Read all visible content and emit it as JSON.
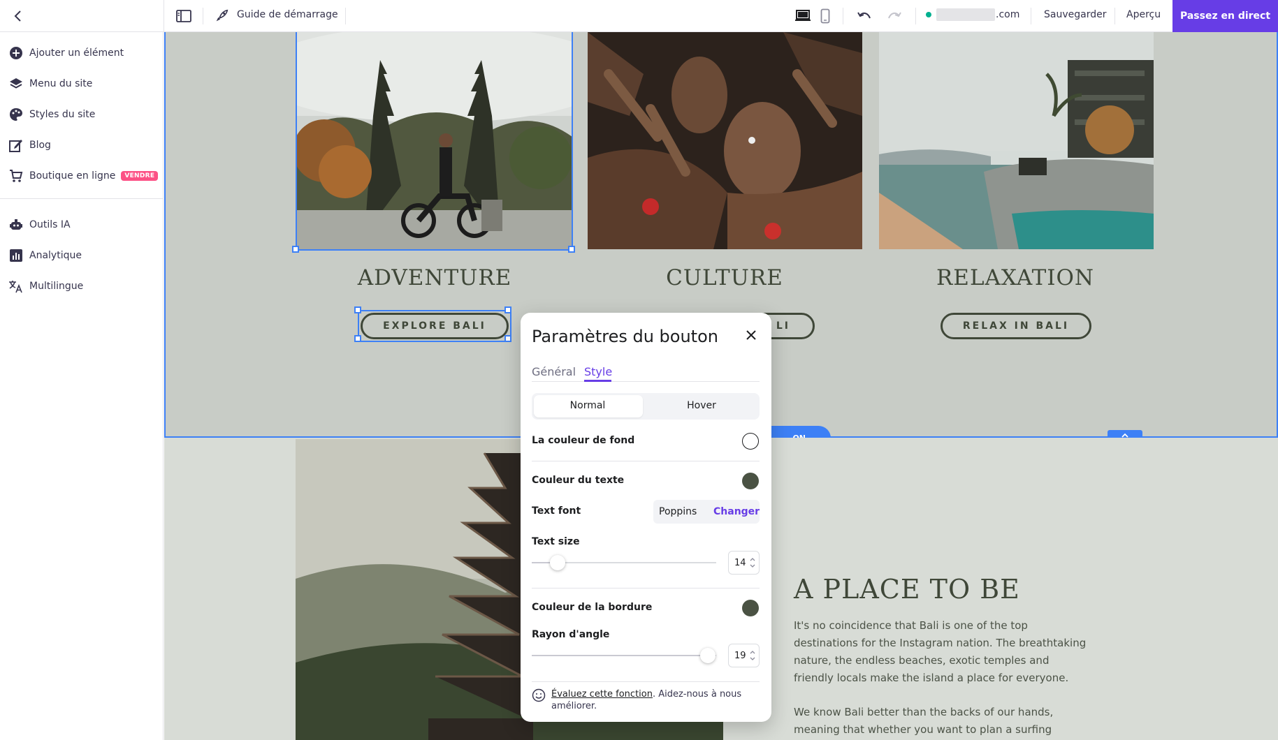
{
  "topbar": {
    "guide_label": "Guide de démarrage",
    "domain_suffix": ".com",
    "save_label": "Sauvegarder",
    "preview_label": "Aperçu",
    "publish_label": "Passez en direct"
  },
  "sidebar": {
    "items": [
      {
        "label": "Ajouter un élément"
      },
      {
        "label": "Menu du site"
      },
      {
        "label": "Styles du site"
      },
      {
        "label": "Blog"
      },
      {
        "label": "Boutique en ligne",
        "badge": "VENDRE"
      },
      {
        "label": "Outils IA"
      },
      {
        "label": "Analytique"
      },
      {
        "label": "Multilingue"
      }
    ]
  },
  "canvas": {
    "columns": [
      {
        "title": "ADVENTURE",
        "button": "EXPLORE BALI"
      },
      {
        "title": "CULTURE",
        "button": "LI"
      },
      {
        "title": "RELAXATION",
        "button": "RELAX IN BALI"
      }
    ],
    "section_tag": "ON",
    "heading": "A PLACE TO BE",
    "paragraph1": "It's no coincidence that Bali is one of the top destinations for the Instagram nation. The breathtaking nature, the endless beaches, exotic temples and friendly locals make the island a place for everyone.",
    "paragraph2": "We know Bali better than the backs of our hands, meaning that whether you want to plan a surfing holiday"
  },
  "dialog": {
    "title": "Paramètres du bouton",
    "tabs": [
      "Général",
      "Style"
    ],
    "active_tab": "Style",
    "state_tabs": [
      "Normal",
      "Hover"
    ],
    "active_state": "Normal",
    "background_label": "La couleur de fond",
    "background_color": "#ffffff",
    "text_color_label": "Couleur du texte",
    "text_color": "#4a5243",
    "font_label": "Text font",
    "font_name": "Poppins",
    "font_change": "Changer",
    "size_label": "Text size",
    "size_value": "14",
    "border_color_label": "Couleur de la bordure",
    "border_color": "#4a5243",
    "radius_label": "Rayon d'angle",
    "radius_value": "19",
    "feedback_link": "Évaluez cette fonction",
    "feedback_text": ". Aidez-nous à nous améliorer."
  },
  "colors": {
    "accent": "#673de6",
    "selection": "#3d80f6",
    "site_green": "#3f4738"
  }
}
